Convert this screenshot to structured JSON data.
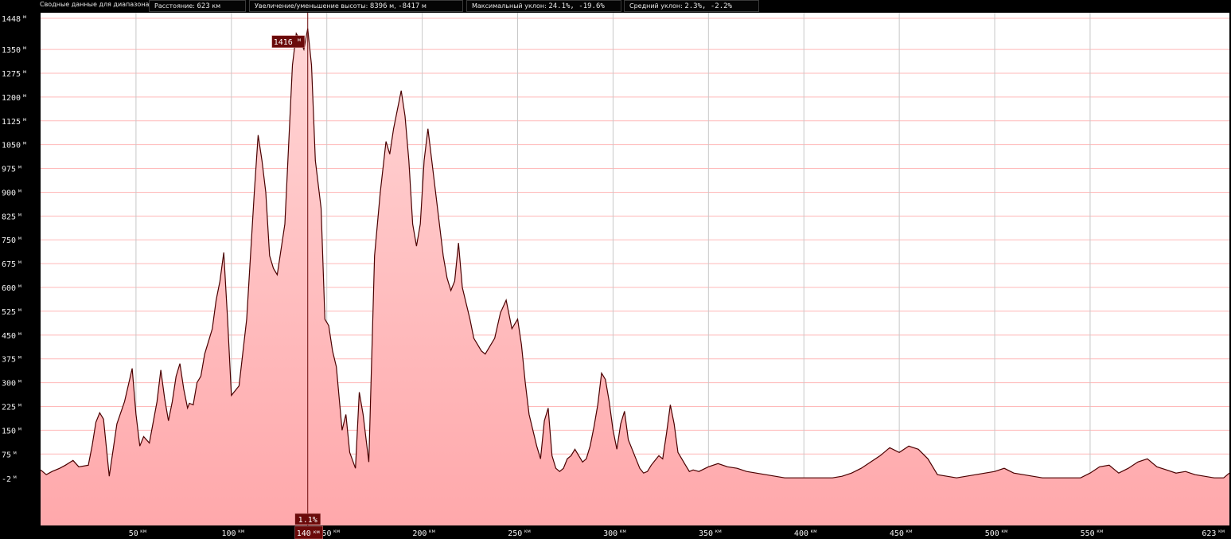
{
  "summary": {
    "range_label": "Сводные данные для диапазона:",
    "distance_label": "Расстояние:",
    "distance_value": "623",
    "distance_unit": "км",
    "gain_label": "Увеличение/уменьшение высоты:",
    "gain_value": "8396",
    "gain_unit": "м,",
    "loss_value": "-8417",
    "loss_unit": "м",
    "max_slope_label": "Максимальный уклон:",
    "max_slope_value": "24.1%, -19.6%",
    "avg_slope_label": "Средний уклон:",
    "avg_slope_value": "2.3%, -2.2%"
  },
  "markers": {
    "peak_value": "1416",
    "peak_unit": "м",
    "cursor_slope": "1.1%",
    "cursor_km": "140",
    "cursor_km_unit": "км"
  },
  "colors": {
    "fill_top": "#ffd6d6",
    "fill_bottom": "#ffa8ab",
    "line": "#4a0000",
    "marker_bg": "#6b0a0a",
    "grid_h": "#ffb9b9",
    "grid_v": "#c8c8c8"
  },
  "chart_data": {
    "type": "area",
    "title": "",
    "xlabel": "",
    "ylabel": "",
    "xlim": [
      0,
      623
    ],
    "ylim": [
      -2,
      1448
    ],
    "y_tick_labels": [
      "1448",
      "1350",
      "1275",
      "1200",
      "1125",
      "1050",
      "975",
      "900",
      "825",
      "750",
      "675",
      "600",
      "525",
      "450",
      "375",
      "300",
      "225",
      "150",
      "75",
      "-2"
    ],
    "y_tick_values": [
      1448,
      1350,
      1275,
      1200,
      1125,
      1050,
      975,
      900,
      825,
      750,
      675,
      600,
      525,
      450,
      375,
      300,
      225,
      150,
      75,
      -2
    ],
    "y_unit": "м",
    "x_tick_labels": [
      "50",
      "100",
      "150",
      "200",
      "250",
      "300",
      "350",
      "400",
      "450",
      "500",
      "550",
      "623"
    ],
    "x_tick_values": [
      50,
      100,
      150,
      200,
      250,
      300,
      350,
      400,
      450,
      500,
      550,
      623
    ],
    "x_unit": "км",
    "cursor_x": 140,
    "peak": {
      "x": 140,
      "y": 1416
    },
    "x": [
      0,
      3,
      6,
      10,
      13,
      17,
      20,
      25,
      27,
      29,
      31,
      33,
      36,
      40,
      44,
      48,
      50,
      52,
      54,
      57,
      61,
      63,
      65,
      67,
      69,
      71,
      73,
      75,
      77,
      78,
      80,
      82,
      84,
      86,
      88,
      90,
      92,
      94,
      96,
      98,
      100,
      104,
      108,
      112,
      114,
      116,
      118,
      120,
      122,
      124,
      128,
      132,
      134,
      136,
      138,
      140,
      142,
      144,
      147,
      149,
      151,
      153,
      155,
      158,
      160,
      162,
      165,
      167,
      169,
      172,
      175,
      178,
      181,
      183,
      185,
      187,
      189,
      191,
      193,
      195,
      197,
      199,
      201,
      203,
      205,
      207,
      209,
      211,
      213,
      215,
      217,
      219,
      221,
      223,
      225,
      227,
      229,
      231,
      233,
      235,
      238,
      241,
      244,
      247,
      250,
      252,
      254,
      256,
      258,
      260,
      262,
      264,
      266,
      268,
      270,
      272,
      274,
      276,
      278,
      280,
      282,
      284,
      286,
      288,
      290,
      292,
      294,
      296,
      298,
      300,
      302,
      304,
      306,
      308,
      310,
      312,
      314,
      316,
      318,
      320,
      322,
      324,
      326,
      328,
      330,
      332,
      334,
      336,
      338,
      340,
      342,
      345,
      350,
      355,
      360,
      365,
      370,
      375,
      380,
      385,
      390,
      395,
      400,
      405,
      410,
      415,
      420,
      425,
      430,
      435,
      440,
      445,
      450,
      455,
      460,
      465,
      470,
      475,
      480,
      485,
      490,
      495,
      500,
      505,
      510,
      515,
      520,
      525,
      530,
      535,
      540,
      545,
      550,
      555,
      560,
      565,
      570,
      575,
      580,
      585,
      590,
      595,
      600,
      605,
      610,
      615,
      620,
      623
    ],
    "y": [
      25,
      10,
      20,
      30,
      40,
      55,
      35,
      40,
      100,
      175,
      205,
      185,
      5,
      170,
      240,
      345,
      200,
      100,
      130,
      110,
      240,
      340,
      250,
      180,
      240,
      320,
      360,
      280,
      220,
      235,
      230,
      300,
      320,
      390,
      430,
      470,
      560,
      620,
      710,
      500,
      260,
      290,
      500,
      900,
      1080,
      1000,
      900,
      700,
      660,
      640,
      800,
      1300,
      1400,
      1380,
      1350,
      1416,
      1300,
      1000,
      850,
      500,
      480,
      400,
      350,
      150,
      200,
      80,
      30,
      270,
      200,
      50,
      700,
      900,
      1060,
      1020,
      1100,
      1160,
      1220,
      1140,
      1000,
      800,
      730,
      800,
      1000,
      1100,
      1000,
      900,
      800,
      700,
      630,
      590,
      620,
      740,
      600,
      550,
      500,
      440,
      420,
      400,
      390,
      410,
      440,
      520,
      560,
      470,
      500,
      420,
      300,
      200,
      150,
      100,
      60,
      180,
      220,
      70,
      30,
      20,
      30,
      60,
      70,
      90,
      70,
      50,
      60,
      100,
      160,
      230,
      330,
      310,
      240,
      150,
      90,
      170,
      210,
      120,
      90,
      60,
      30,
      15,
      20,
      40,
      55,
      70,
      60,
      140,
      230,
      170,
      80,
      60,
      40,
      20,
      25,
      20,
      35,
      45,
      35,
      30,
      20,
      15,
      10,
      5,
      0,
      0,
      0,
      0,
      0,
      0,
      5,
      15,
      30,
      50,
      70,
      95,
      80,
      100,
      90,
      60,
      10,
      5,
      0,
      5,
      10,
      15,
      20,
      30,
      15,
      10,
      5,
      0,
      0,
      0,
      0,
      0,
      15,
      35,
      40,
      15,
      30,
      50,
      60,
      35,
      25,
      15,
      20,
      10,
      5,
      0,
      0,
      15,
      25,
      45,
      15,
      5,
      15,
      20,
      25,
      10
    ]
  }
}
